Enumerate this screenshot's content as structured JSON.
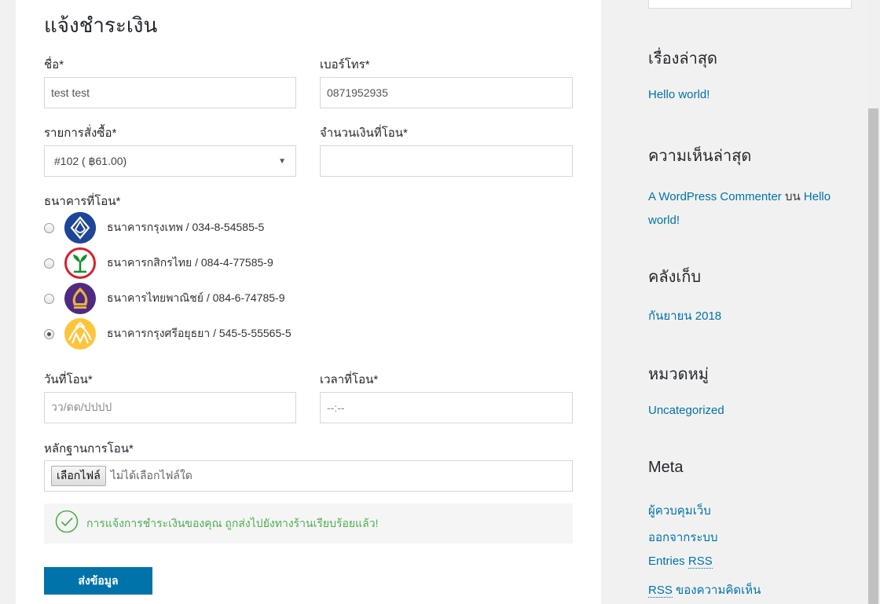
{
  "form": {
    "title": "แจ้งชำระเงิน",
    "name_label": "ชื่อ*",
    "name_value": "test test",
    "phone_label": "เบอร์โทร*",
    "phone_value": "0871952935",
    "order_label": "รายการสั่งซื้อ*",
    "order_value": "#102 ( ฿61.00)",
    "amount_label": "จำนวนเงินที่โอน*",
    "amount_value": "",
    "bank_label": "ธนาคารที่โอน*",
    "banks": [
      {
        "label": "ธนาคารกรุงเทพ / 034-8-54585-5",
        "color": "#1e4598",
        "icon": "bangkok-bank-logo",
        "checked": false
      },
      {
        "label": "ธนาคารกสิกรไทย / 084-4-77585-9",
        "color": "#138f2d",
        "icon": "kasikorn-bank-logo",
        "checked": false
      },
      {
        "label": "ธนาคารไทยพาณิชย์ / 084-6-74785-9",
        "color": "#4e2a84",
        "icon": "scb-bank-logo",
        "checked": false
      },
      {
        "label": "ธนาคารกรุงศรีอยุธยา / 545-5-55565-5",
        "color": "#fec43b",
        "icon": "krungsri-bank-logo",
        "checked": true
      }
    ],
    "date_label": "วันที่โอน*",
    "date_placeholder": "วว/ดด/ปปปป",
    "time_label": "เวลาที่โอน*",
    "time_placeholder": "--:--",
    "proof_label": "หลักฐานการโอน*",
    "file_button": "เลือกไฟล์",
    "file_status": "ไม่ได้เลือกไฟล์ใด",
    "success_message": "การแจ้งการชำระเงินของคุณ ถูกส่งไปยังทางร้านเรียบร้อยแล้ว!",
    "submit_label": "ส่งข้อมูล"
  },
  "sidebar": {
    "recent_posts_title": "เรื่องล่าสุด",
    "recent_posts": [
      "Hello world!"
    ],
    "recent_comments_title": "ความเห็นล่าสุด",
    "comment_author": "A WordPress Commenter",
    "comment_on": "บน",
    "comment_post_line1": "Hello",
    "comment_post_line2": "world!",
    "archives_title": "คลังเก็บ",
    "archives": [
      "กันยายน 2018"
    ],
    "categories_title": "หมวดหมู่",
    "categories": [
      "Uncategorized"
    ],
    "meta_title": "Meta",
    "meta_admin": "ผู้ควบคุมเว็บ",
    "meta_logout": "ออกจากระบบ",
    "meta_entries_prefix": "Entries",
    "meta_entries_rss": "RSS",
    "meta_comments_rss": "RSS",
    "meta_comments_suffix": "ของความคิดเห็น"
  },
  "colors": {
    "link": "#0073aa",
    "success": "#4caf50",
    "button": "#0073aa"
  }
}
